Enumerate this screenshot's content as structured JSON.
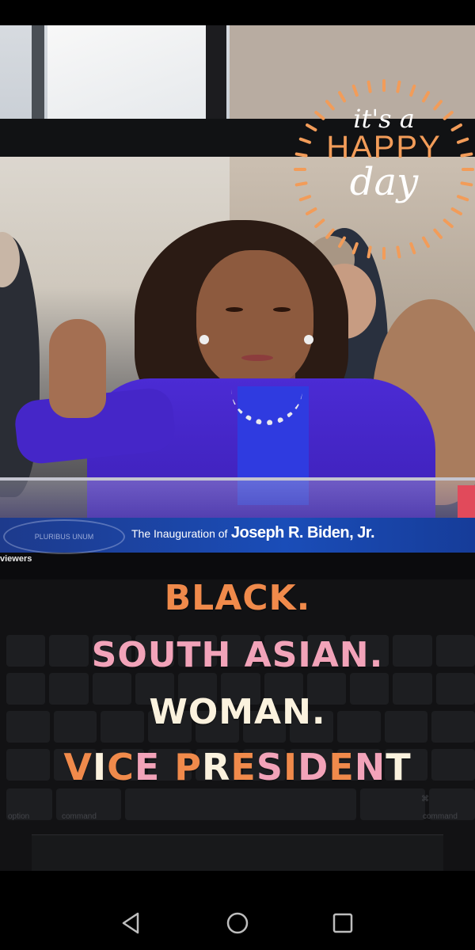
{
  "video": {
    "lower_third_prefix": "The Inauguration of",
    "lower_third_name": "Joseph R. Biden, Jr.",
    "seal_text": "PLURIBUS UNUM",
    "viewers_label": "viewers"
  },
  "sticker": {
    "line1": "it's a",
    "line2": "HAPPY",
    "line3": "day"
  },
  "caption": {
    "line1": "BLACK.",
    "line2": "SOUTH ASIAN.",
    "line3": "WOMAN.",
    "line4": "VICE PRESIDENT",
    "line4_letter_colors": [
      "#f08a4b",
      "#fbf2de",
      "#f08a4b",
      "#f2a3b9",
      "#f08a4b",
      "#fbf2de",
      "#f08a4b",
      "#f2a3b9",
      "#f08a4b",
      "#f2a3b9",
      "#f08a4b",
      "#f2a3b9",
      "#fbf2de",
      "#f08a4b"
    ]
  },
  "keyboard": {
    "label_option": "option",
    "label_command_left": "command",
    "label_command_right": "command",
    "label_cmd_symbol": "⌘"
  },
  "nav": {
    "back_icon": "triangle-back-icon",
    "home_icon": "circle-home-icon",
    "recents_icon": "square-recents-icon"
  },
  "colors": {
    "orange": "#f08a4b",
    "pink": "#f2a3b9",
    "cream": "#fbf2de",
    "suit_purple": "#4b2bd4",
    "banner_blue": "#1a4db8"
  }
}
